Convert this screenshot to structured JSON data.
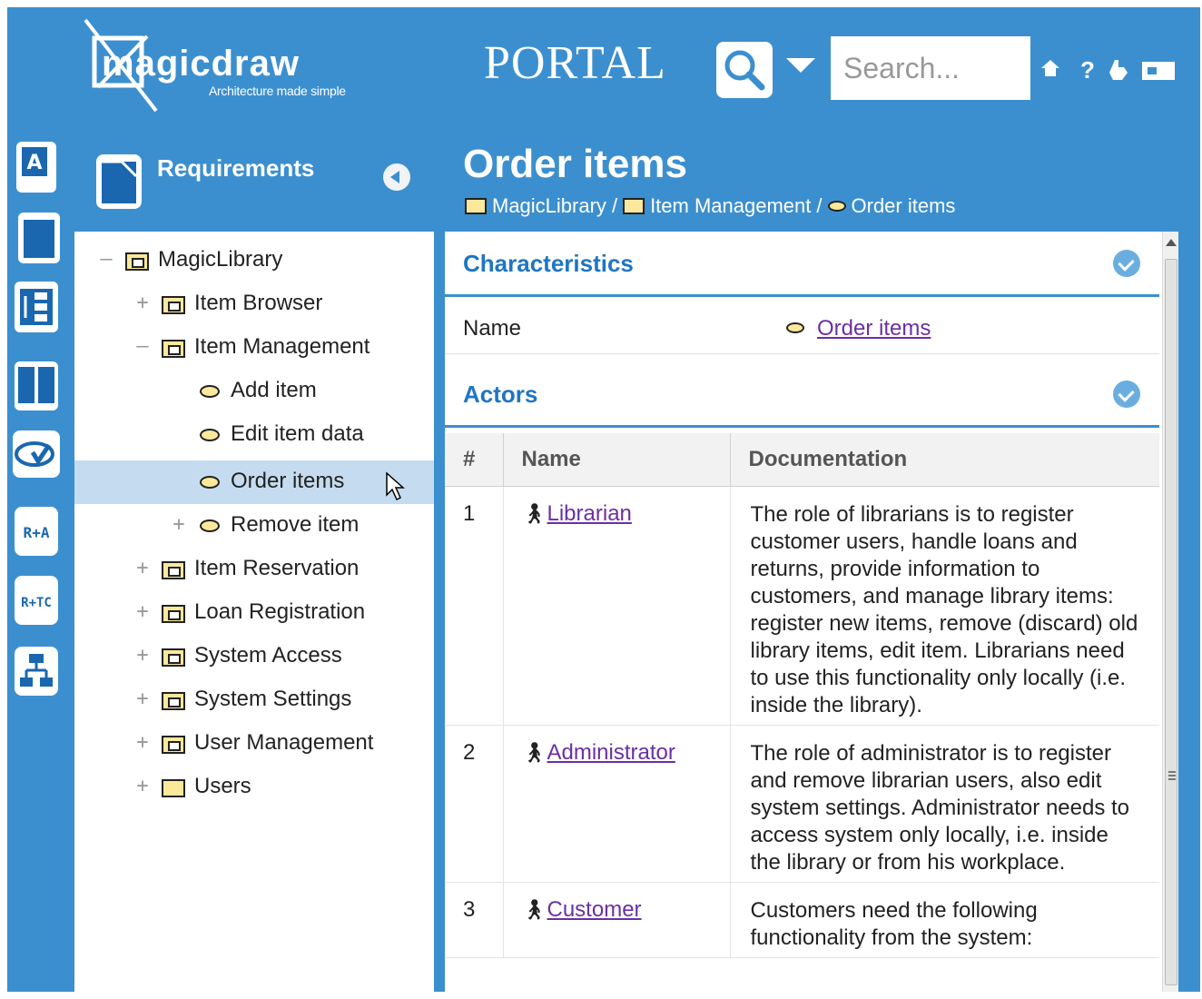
{
  "header": {
    "logo_word": "magicdraw",
    "logo_tagline": "Architecture made simple",
    "portal_title": "PORTAL",
    "search_placeholder": "Search...",
    "icons": [
      "search-icon",
      "chevron-down-icon",
      "home-icon",
      "help-icon",
      "hand-icon",
      "card-icon"
    ]
  },
  "sidebar_icons": [
    "document-a-icon",
    "document-icon",
    "hierarchy-icon",
    "book-icon",
    "usecase-check-icon",
    "r-a-icon",
    "r-tc-icon",
    "org-chart-icon"
  ],
  "sidebar_labels": {
    "ra": "R+A",
    "rtc": "R+TC",
    "doc_letter": "A"
  },
  "tree": {
    "title": "Requirements",
    "items": [
      {
        "label": "MagicLibrary",
        "toggle": "–",
        "type": "package"
      },
      {
        "label": "Item Browser",
        "toggle": "+",
        "type": "package"
      },
      {
        "label": "Item Management",
        "toggle": "–",
        "type": "package"
      },
      {
        "label": "Add item",
        "toggle": "",
        "type": "usecase"
      },
      {
        "label": "Edit item data",
        "toggle": "",
        "type": "usecase"
      },
      {
        "label": "Order items",
        "toggle": "",
        "type": "usecase",
        "selected": true
      },
      {
        "label": "Remove item",
        "toggle": "+",
        "type": "usecase"
      },
      {
        "label": "Item Reservation",
        "toggle": "+",
        "type": "package"
      },
      {
        "label": "Loan Registration",
        "toggle": "+",
        "type": "package"
      },
      {
        "label": "System Access",
        "toggle": "+",
        "type": "package"
      },
      {
        "label": "System Settings",
        "toggle": "+",
        "type": "package"
      },
      {
        "label": "User Management",
        "toggle": "+",
        "type": "package"
      },
      {
        "label": "Users",
        "toggle": "+",
        "type": "folder"
      }
    ]
  },
  "content": {
    "title": "Order items",
    "breadcrumb": [
      "MagicLibrary",
      "/",
      "Item Management",
      "/",
      "Order items"
    ],
    "characteristics": {
      "title": "Characteristics",
      "name_label": "Name",
      "name_value": "Order items"
    },
    "actors": {
      "title": "Actors",
      "columns": [
        "#",
        "Name",
        "Documentation"
      ],
      "rows": [
        {
          "num": "1",
          "name": "Librarian",
          "doc": "The role of librarians is to register customer users, handle loans and returns, provide information to customers, and manage library items: register new items, remove (discard) old library items, edit item. Librarians need to use this functionality only locally (i.e. inside the library)."
        },
        {
          "num": "2",
          "name": "Administrator",
          "doc": "The role of administrator is to register and remove librarian users, also edit system settings. Administrator needs to access system only locally, i.e. inside the library or from his workplace."
        },
        {
          "num": "3",
          "name": "Customer",
          "doc": "Customers need the following functionality from the system:"
        }
      ]
    }
  },
  "colors": {
    "brand_blue": "#3c8fcf",
    "link_purple": "#6b2fa3",
    "section_title": "#1f76c2",
    "selected_row": "#c5dcf0"
  }
}
